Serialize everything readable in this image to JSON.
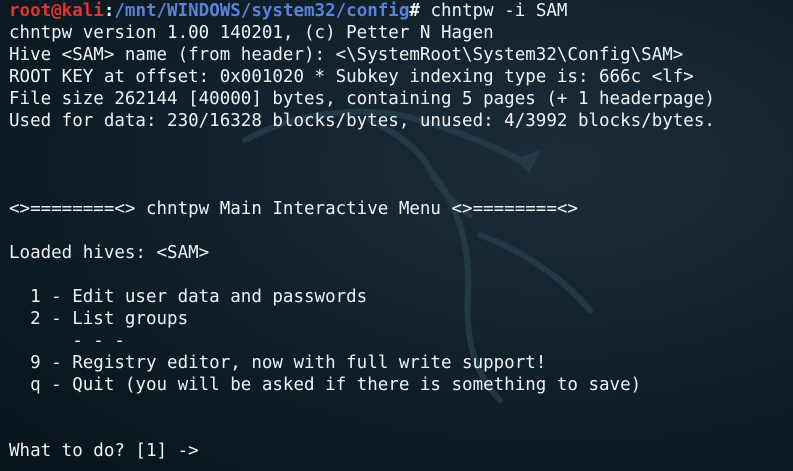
{
  "prompt": {
    "user": "root@kali",
    "separator": ":",
    "path": "/mnt/WINDOWS/system32/config",
    "symbol": "#",
    "command": " chntpw -i SAM"
  },
  "output": {
    "version": "chntpw version 1.00 140201, (c) Petter N Hagen",
    "hive_name": "Hive <SAM> name (from header): <\\SystemRoot\\System32\\Config\\SAM>",
    "root_key": "ROOT KEY at offset: 0x001020 * Subkey indexing type is: 666c <lf>",
    "file_size": "File size 262144 [40000] bytes, containing 5 pages (+ 1 headerpage)",
    "used_data": "Used for data: 230/16328 blocks/bytes, unused: 4/3992 blocks/bytes."
  },
  "menu": {
    "header": "<>========<> chntpw Main Interactive Menu <>========<>",
    "loaded_hives": "Loaded hives: <SAM>",
    "items": [
      "  1 - Edit user data and passwords",
      "  2 - List groups",
      "      - - -",
      "  9 - Registry editor, now with full write support!",
      "  q - Quit (you will be asked if there is something to save)"
    ],
    "input_prompt": "What to do? [1] ->"
  },
  "colors": {
    "prompt_user": "#e0352c",
    "prompt_path": "#5a82d8",
    "text": "#eef2f4",
    "background": "#0b1820"
  }
}
